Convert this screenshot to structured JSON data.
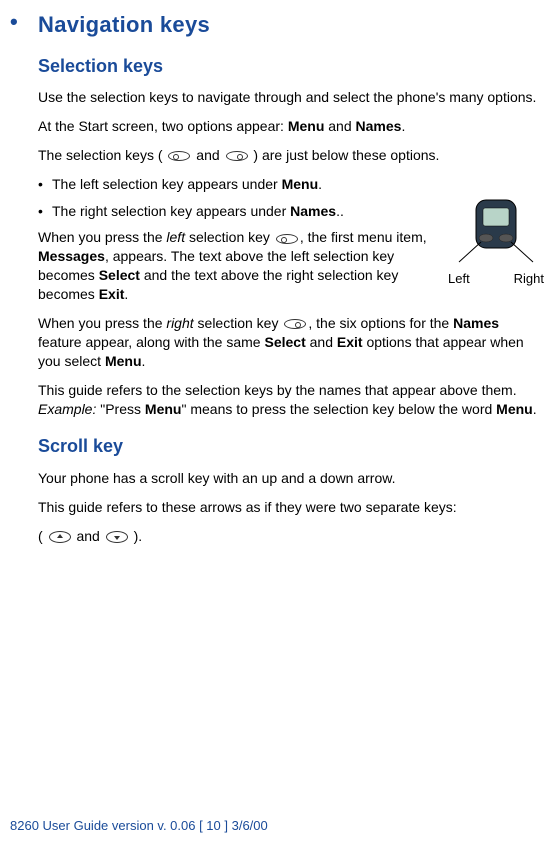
{
  "header": {
    "bullet": "•",
    "title": "Navigation keys"
  },
  "selection": {
    "heading": "Selection keys",
    "p1": "Use the selection keys to navigate through and select the phone's many options.",
    "p2a": "At the Start screen, two options appear: ",
    "p2b": "Menu",
    "p2c": " and ",
    "p2d": "Names",
    "p2e": ".",
    "p3a": "The selection keys ( ",
    "p3b": " and ",
    "p3c": " ) are just below these options.",
    "li1a": "The left selection key appears under ",
    "li1b": "Menu",
    "li1c": ".",
    "li2a": "The right selection key appears under ",
    "li2b": "Names",
    "li2c": "..",
    "p4a": "When you press the ",
    "p4b": "left",
    "p4c": " selection key ",
    "p4d": ", the first menu item, ",
    "p4e": "Messages",
    "p4f": ", appears. The text above the left selection key becomes ",
    "p4g": "Select",
    "p4h": " and the text above the right selection key becomes ",
    "p4i": "Exit",
    "p4j": ".",
    "p5a": "When you press the ",
    "p5b": "right",
    "p5c": " selection key ",
    "p5d": ", the six options for the ",
    "p5e": "Names",
    "p5f": " feature appear, along with the same ",
    "p5g": "Select",
    "p5h": " and ",
    "p5i": "Exit",
    "p5j": " options that appear when you select ",
    "p5k": "Menu",
    "p5l": ".",
    "p6a": "This guide refers to the selection keys by the names that appear above them. ",
    "p6b": "Example:",
    "p6c": " \"Press ",
    "p6d": "Menu",
    "p6e": "\" means to press the selection key below the word ",
    "p6f": "Menu",
    "p6g": "."
  },
  "phone": {
    "left_label": "Left",
    "right_label": "Right"
  },
  "scroll": {
    "heading": "Scroll key",
    "p1": "Your phone has a scroll key with an up and a down arrow.",
    "p2": "This guide refers to these arrows as if they were two separate keys:",
    "p3a": "( ",
    "p3b": " and ",
    "p3c": " )."
  },
  "footer": "8260 User Guide version v. 0.06 [ 10 ] 3/6/00",
  "bullet_dot": "•"
}
